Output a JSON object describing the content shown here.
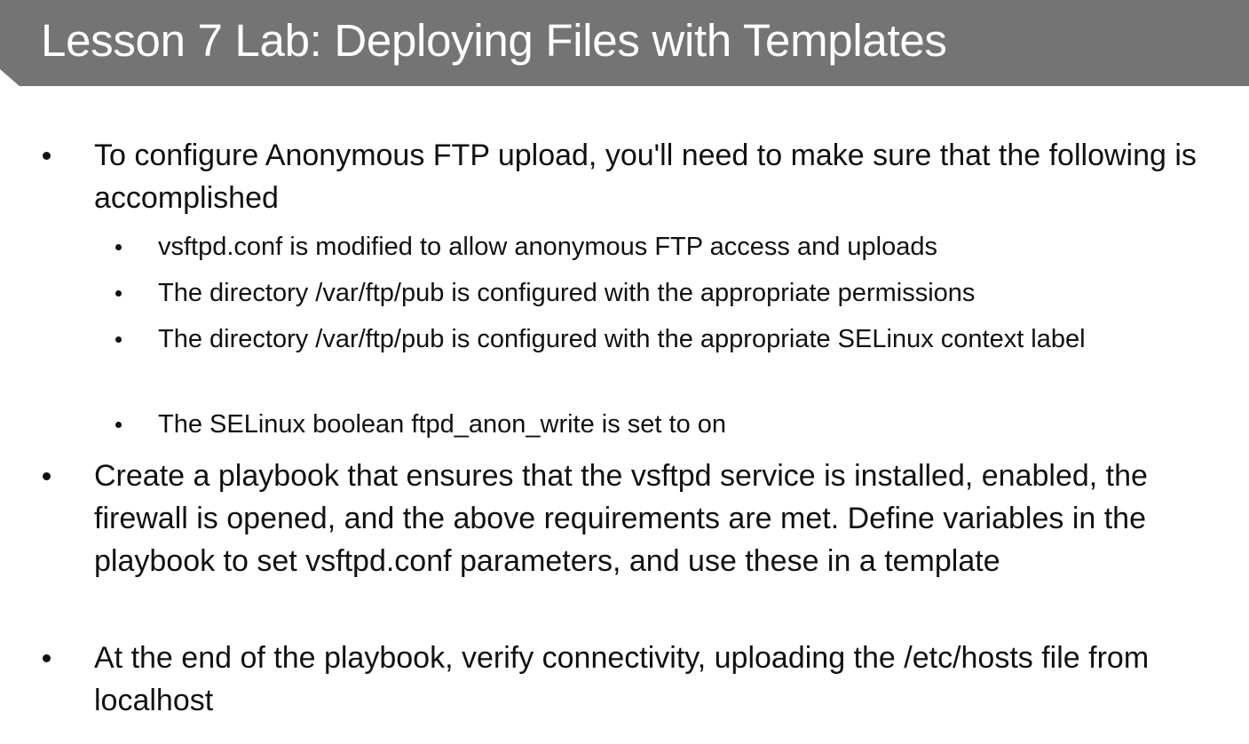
{
  "slide": {
    "title": "Lesson 7 Lab: Deploying Files with Templates"
  },
  "bullets": [
    {
      "text": "To configure Anonymous FTP upload, you'll need to make sure that the following is accomplished",
      "sub": [
        "vsftpd.conf is modified to allow anonymous FTP access and uploads",
        "The directory /var/ftp/pub is configured with the appropriate permissions",
        "The directory /var/ftp/pub is configured with the appropriate SELinux context label",
        "The SELinux boolean ftpd_anon_write is set to on"
      ]
    },
    {
      "text": "Create a playbook that ensures that the vsftpd service is installed, enabled, the firewall is opened, and the above requirements are met. Define variables in the playbook to set vsftpd.conf parameters, and use these in a template"
    },
    {
      "text": "At the end of the playbook, verify connectivity, uploading the /etc/hosts file from localhost"
    }
  ]
}
